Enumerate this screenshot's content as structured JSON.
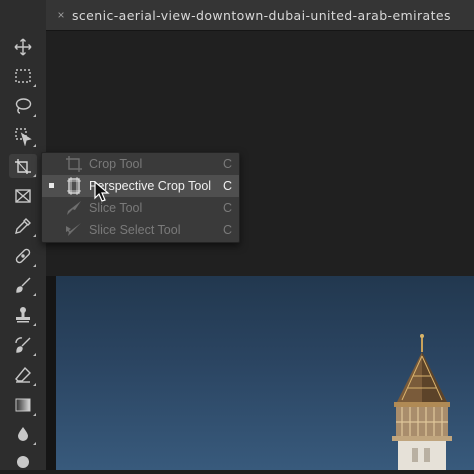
{
  "document": {
    "tab_close": "×",
    "tab_title": "scenic-aerial-view-downtown-dubai-united-arab-emirates"
  },
  "toolbar": {
    "tools": [
      {
        "name": "move-tool"
      },
      {
        "name": "rectangular-marquee-tool"
      },
      {
        "name": "lasso-tool"
      },
      {
        "name": "object-selection-tool"
      },
      {
        "name": "crop-tool",
        "active": true
      },
      {
        "name": "frame-tool"
      },
      {
        "name": "eyedropper-tool"
      },
      {
        "name": "spot-healing-brush-tool"
      },
      {
        "name": "brush-tool"
      },
      {
        "name": "clone-stamp-tool"
      },
      {
        "name": "history-brush-tool"
      },
      {
        "name": "eraser-tool"
      },
      {
        "name": "gradient-tool"
      },
      {
        "name": "blur-tool"
      },
      {
        "name": "dodge-tool"
      }
    ]
  },
  "flyout": {
    "items": [
      {
        "label": "Crop Tool",
        "shortcut": "C",
        "icon": "crop-icon",
        "selected": false
      },
      {
        "label": "Perspective Crop Tool",
        "shortcut": "C",
        "icon": "perspective-crop-icon",
        "selected": true
      },
      {
        "label": "Slice Tool",
        "shortcut": "C",
        "icon": "slice-icon",
        "selected": false
      },
      {
        "label": "Slice Select Tool",
        "shortcut": "C",
        "icon": "slice-select-icon",
        "selected": false
      }
    ]
  },
  "colors": {
    "toolbar_bg": "#2d2d2d",
    "menu_bg": "#3a3a3a",
    "menu_selected_bg": "#4f4f4f",
    "sky": "#2b4562"
  }
}
